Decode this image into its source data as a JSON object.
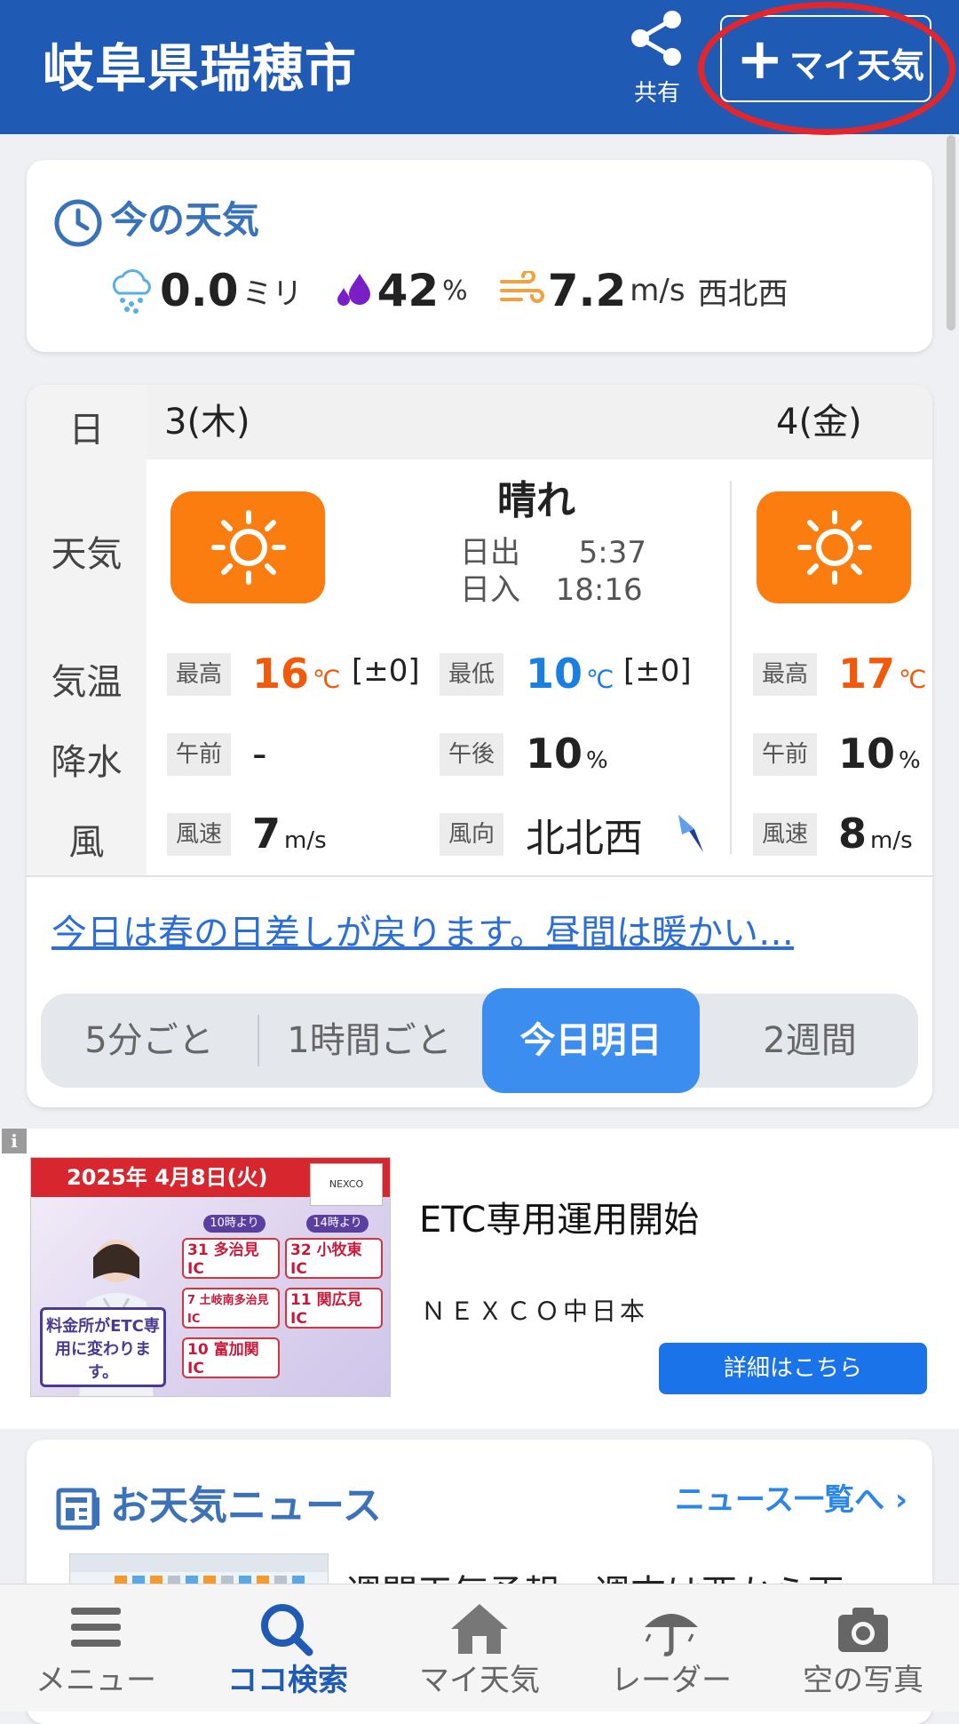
{
  "header": {
    "title": "岐阜県瑞穂市",
    "share_label": "共有",
    "my_weather_label": "マイ天気",
    "plus_glyph": "+"
  },
  "now": {
    "title": "今の天気",
    "precip_value": "0.0",
    "precip_unit": "ミリ",
    "humidity_value": "42",
    "humidity_unit": "%",
    "wind_value": "7.2",
    "wind_unit": "m/s",
    "wind_dir": "西北西"
  },
  "forecast": {
    "row_labels": {
      "day": "日",
      "weather": "天気",
      "temp": "気温",
      "precip": "降水",
      "wind": "風"
    },
    "today": {
      "date": "3(木)",
      "weather": "晴れ",
      "sunrise_label": "日出",
      "sunrise": "5:37",
      "sunset_label": "日入",
      "sunset": "18:16",
      "high_label": "最高",
      "high": "16",
      "high_unit": "℃",
      "high_diff": "[±0]",
      "low_label": "最低",
      "low": "10",
      "low_unit": "℃",
      "low_diff": "[±0]",
      "am_label": "午前",
      "am_precip": "-",
      "pm_label": "午後",
      "pm_precip": "10",
      "pm_unit": "%",
      "wind_speed_label": "風速",
      "wind_speed": "7",
      "wind_speed_unit": "m/s",
      "wind_dir_label": "風向",
      "wind_dir": "北北西"
    },
    "tomorrow": {
      "date": "4(金)",
      "high_label": "最高",
      "high": "17",
      "high_unit": "℃",
      "am_label": "午前",
      "am_precip": "10",
      "am_unit": "%",
      "wind_speed_label": "風速",
      "wind_speed": "8",
      "wind_speed_unit": "m/s"
    },
    "headline_link": "今日は春の日差しが戻ります。昼間は暖かい…",
    "tabs": [
      "5分ごと",
      "1時間ごと",
      "今日明日",
      "2週間"
    ],
    "active_tab": "今日明日"
  },
  "ad": {
    "info_glyph": "i",
    "banner_date": "2025年 4月8日(火)",
    "logo_text": "NEXCO",
    "badge_text": "料金所がETC専用に変わります。",
    "time1": "10時より",
    "time2": "14時より",
    "ic1": "31 多治見IC",
    "ic2": "32 小牧東IC",
    "ic3": "7 土岐南多治見IC",
    "ic4": "11 関広見IC",
    "ic5": "10 富加関IC",
    "title": "ETC専用運用開始",
    "sponsor": "ＮＥＸＣＯ中日本",
    "button": "詳細はこちら"
  },
  "news": {
    "title": "お天気ニュース",
    "more_link": "ニュース一覧へ",
    "item_title": "週間天気予報　週末は西から雨"
  },
  "bottom_nav": [
    {
      "label": "メニュー",
      "icon": "hamburger-icon"
    },
    {
      "label": "ココ検索",
      "icon": "search-icon"
    },
    {
      "label": "マイ天気",
      "icon": "home-icon"
    },
    {
      "label": "レーダー",
      "icon": "umbrella-icon"
    },
    {
      "label": "空の写真",
      "icon": "camera-icon"
    }
  ],
  "colors": {
    "header_bg": "#1f5bb5",
    "accent_blue": "#3b8ef0",
    "sun_orange": "#fb7d10",
    "hot": "#f15a0b",
    "cold": "#1a7fe0",
    "highlight_ring": "#e2262c"
  }
}
